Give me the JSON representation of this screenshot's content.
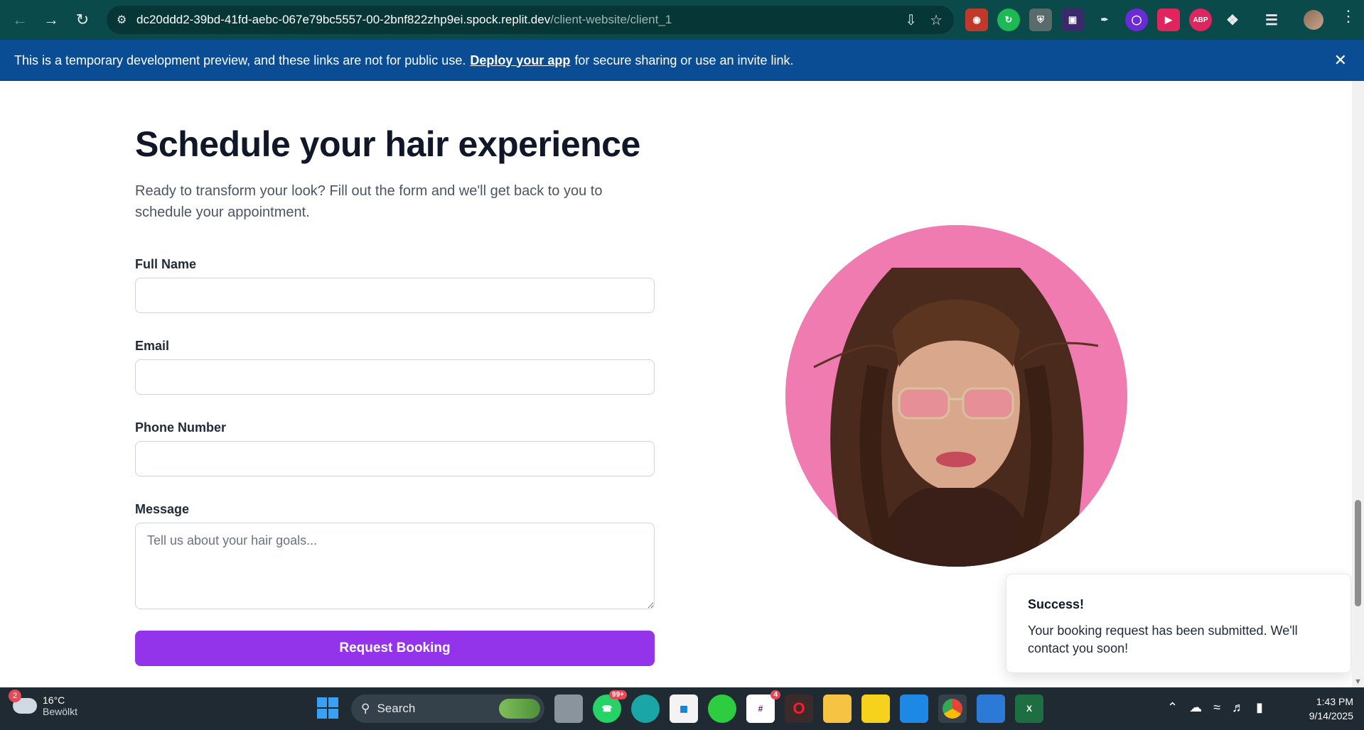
{
  "browser": {
    "url_host": "dc20ddd2-39bd-41fd-aebc-067e79bc5557-00-2bnf822zhp9ei.spock.replit.dev",
    "url_path": "/client-website/client_1"
  },
  "banner": {
    "text_before": "This is a temporary development preview, and these links are not for public use.",
    "link": "Deploy your app",
    "text_after": "for secure sharing or use an invite link."
  },
  "form": {
    "heading": "Schedule your hair experience",
    "subtitle": "Ready to transform your look? Fill out the form and we'll get back to you to schedule your appointment.",
    "full_name_label": "Full Name",
    "email_label": "Email",
    "phone_label": "Phone Number",
    "message_label": "Message",
    "message_placeholder": "Tell us about your hair goals...",
    "submit_label": "Request Booking"
  },
  "toast": {
    "title": "Success!",
    "body": "Your booking request has been submitted. We'll contact you soon!"
  },
  "taskbar": {
    "weather_temp": "16°C",
    "weather_desc": "Bewölkt",
    "weather_badge": "2",
    "search_label": "Search",
    "whatsapp_badge": "99+",
    "slack_badge": "4",
    "time": "1:43 PM",
    "date": "9/14/2025"
  },
  "extensions": {
    "abp_label": "ABP"
  }
}
